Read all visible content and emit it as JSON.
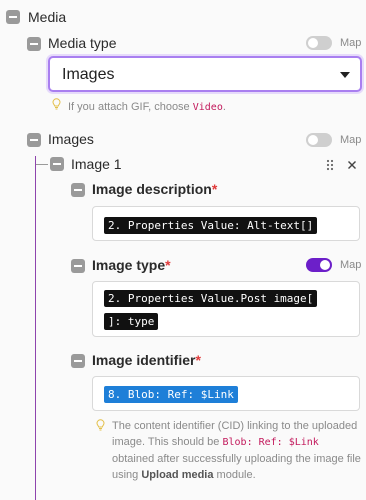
{
  "media": {
    "label": "Media"
  },
  "media_type": {
    "label": "Media type",
    "map_label": "Map",
    "selected": "Images",
    "hint_prefix": "If you attach GIF, choose ",
    "hint_link": "Video",
    "hint_suffix": "."
  },
  "images": {
    "label": "Images",
    "map_label": "Map",
    "item": {
      "label": "Image 1",
      "drag_icon": "drag-handle-icon",
      "close_icon": "close-icon",
      "description": {
        "label": "Image description",
        "required": "*",
        "value": "2. Properties Value: Alt-text[]"
      },
      "type": {
        "label": "Image type",
        "required": "*",
        "map_label": "Map",
        "map_on": true,
        "value_line1": "2. Properties Value.Post image[",
        "value_line2": "]: type"
      },
      "identifier": {
        "label": "Image identifier",
        "required": "*",
        "value": "8. Blob: Ref: $Link",
        "hint_part1": "The content identifier (CID) linking to the uploaded image. This should be ",
        "hint_code": "Blob: Ref: $Link",
        "hint_part2": " obtained after successfully uploading the image file using ",
        "hint_bold": "Upload media",
        "hint_part3": " module."
      }
    }
  },
  "colors": {
    "accent": "#6c1fc9",
    "focus_border": "#a97ff0",
    "required": "#e03a3a",
    "pill_dark": "#111111",
    "pill_blue": "#1e7fd8",
    "tree_line": "#8e44ad"
  }
}
